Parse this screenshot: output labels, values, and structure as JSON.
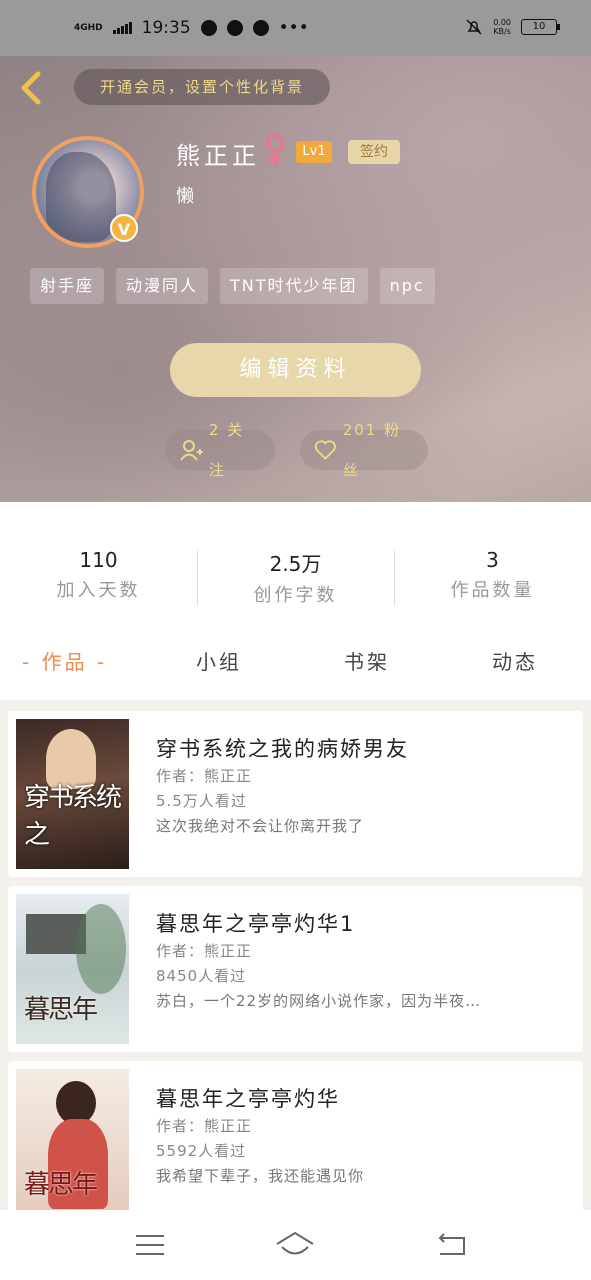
{
  "status_bar": {
    "network": "4GHD",
    "time": "19:35",
    "speed": "0.00",
    "speed_unit": "KB/s",
    "battery": "10",
    "more": "•••"
  },
  "header": {
    "vip_banner": "开通会员，设置个性化背景",
    "username": "熊正正",
    "level": "Lv1",
    "signed": "签约",
    "bio": "懒",
    "verified_badge": "V",
    "tags": [
      "射手座",
      "动漫同人",
      "TNT时代少年团",
      "npc"
    ],
    "edit_button": "编辑资料",
    "follow_label": "2 关注",
    "fans_label": "201 粉丝"
  },
  "stats": [
    {
      "value": "110",
      "label": "加入天数"
    },
    {
      "value": "2.5万",
      "label": "创作字数"
    },
    {
      "value": "3",
      "label": "作品数量"
    }
  ],
  "tabs": [
    "- 作品 -",
    "小组",
    "书架",
    "动态"
  ],
  "active_tab": "作品",
  "books": [
    {
      "title": "穿书系统之我的病娇男友",
      "author": "作者：熊正正",
      "views": "5.5万人看过",
      "intro": "这次我绝对不会让你离开我了",
      "cover_text": "穿书系统之"
    },
    {
      "title": "暮思年之亭亭灼华1",
      "author": "作者：熊正正",
      "views": "8450人看过",
      "intro": "苏白，一个22岁的网络小说作家，因为半夜…",
      "cover_text": "暮思年"
    },
    {
      "title": "暮思年之亭亭灼华",
      "author": "作者：熊正正",
      "views": "5592人看过",
      "intro": "我希望下辈子，我还能遇见你",
      "cover_text": "暮思年"
    }
  ],
  "colors": {
    "accent": "#ee8a4c",
    "gold": "#f0d98a",
    "edit_button": "#e7d7ab"
  },
  "icons": [
    "back-chevron-icon",
    "female-icon",
    "follow-person-icon",
    "heart-icon",
    "menu-icon",
    "home-icon",
    "back-icon"
  ]
}
